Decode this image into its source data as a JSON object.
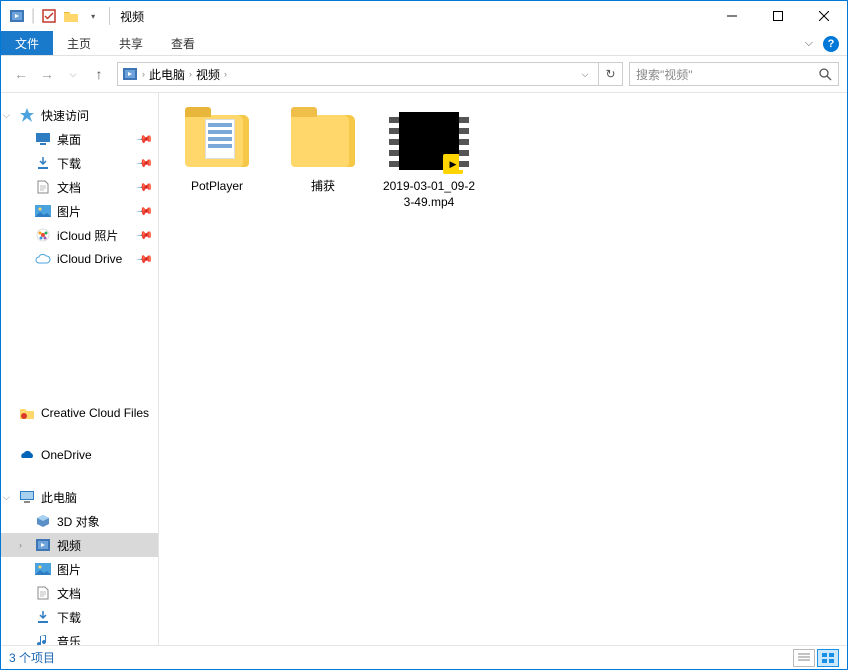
{
  "window": {
    "title": "视频"
  },
  "ribbon": {
    "file": "文件",
    "home": "主页",
    "share": "共享",
    "view": "查看"
  },
  "nav": {
    "breadcrumbs": [
      "此电脑",
      "视频"
    ],
    "search_placeholder": "搜索\"视频\""
  },
  "sidebar": {
    "quick_access": "快速访问",
    "quick": {
      "desktop": "桌面",
      "downloads": "下载",
      "documents": "文档",
      "pictures": "图片",
      "icloud_photos": "iCloud 照片",
      "icloud_drive": "iCloud Drive"
    },
    "cc_files": "Creative Cloud Files",
    "onedrive": "OneDrive",
    "this_pc": "此电脑",
    "pc": {
      "objects3d": "3D 对象",
      "videos": "视频",
      "pictures": "图片",
      "documents": "文档",
      "downloads": "下载",
      "music": "音乐"
    }
  },
  "items": {
    "0": {
      "name": "PotPlayer"
    },
    "1": {
      "name": "捕获"
    },
    "2": {
      "name": "2019-03-01_09-23-49.mp4"
    }
  },
  "status": {
    "count": "3 个项目"
  }
}
